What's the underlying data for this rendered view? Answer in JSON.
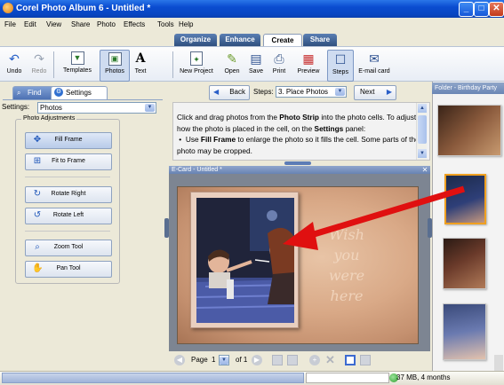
{
  "window": {
    "title": "Corel Photo Album 6 - Untitled *"
  },
  "menu": [
    "File",
    "Edit",
    "View",
    "Share",
    "Photo",
    "Effects",
    "Tools",
    "Help"
  ],
  "main_tabs": [
    {
      "label": "Organize",
      "active": false
    },
    {
      "label": "Enhance",
      "active": false
    },
    {
      "label": "Create",
      "active": true
    },
    {
      "label": "Share",
      "active": false
    }
  ],
  "toolbar": {
    "undo": "Undo",
    "redo": "Redo",
    "templates": "Templates",
    "photos": "Photos",
    "text": "Text",
    "new_project": "New Project",
    "open": "Open",
    "save": "Save",
    "print": "Print",
    "preview": "Preview",
    "steps": "Steps",
    "email_card": "E-mail card"
  },
  "left_panel": {
    "find_tab": "Find",
    "settings_tab": "Settings",
    "settings_label": "Settings:",
    "settings_value": "Photos",
    "group_caption": "Photo Adjustments",
    "buttons": {
      "fill_frame": "Fill Frame",
      "fit_to_frame": "Fit to Frame",
      "rotate_right": "Rotate Right",
      "rotate_left": "Rotate Left",
      "zoom_tool": "Zoom Tool",
      "pan_tool": "Pan Tool"
    }
  },
  "steps": {
    "back": "Back",
    "label": "Steps:",
    "value": "3. Place Photos",
    "next": "Next"
  },
  "instructions": {
    "t1": "Click and drag photos from the ",
    "b1": "Photo Strip",
    "t2": " into the photo cells. To adjust how the photo is placed in the cell, on the ",
    "b2": "Settings",
    "t3": " panel:",
    "bullet_t1": "Use ",
    "bullet_b1": "Fill Frame",
    "bullet_t2": " to enlarge the photo so it fills the cell. Some parts of the photo may be cropped."
  },
  "ecard": {
    "title": "E-Card - Untitled *",
    "card_text": [
      "Wish",
      "you",
      "were",
      "here"
    ]
  },
  "page_bar": {
    "page_label": "Page",
    "page_value": "1",
    "of_label": "of 1"
  },
  "photo_strip": {
    "title": "Folder - Birthday Party"
  },
  "status": {
    "memory": "37 MB, 4 months"
  },
  "colors": {
    "arrow": "#e01010",
    "title_bar": "#0a4cd0",
    "selected_thumb": "#f0a020"
  }
}
